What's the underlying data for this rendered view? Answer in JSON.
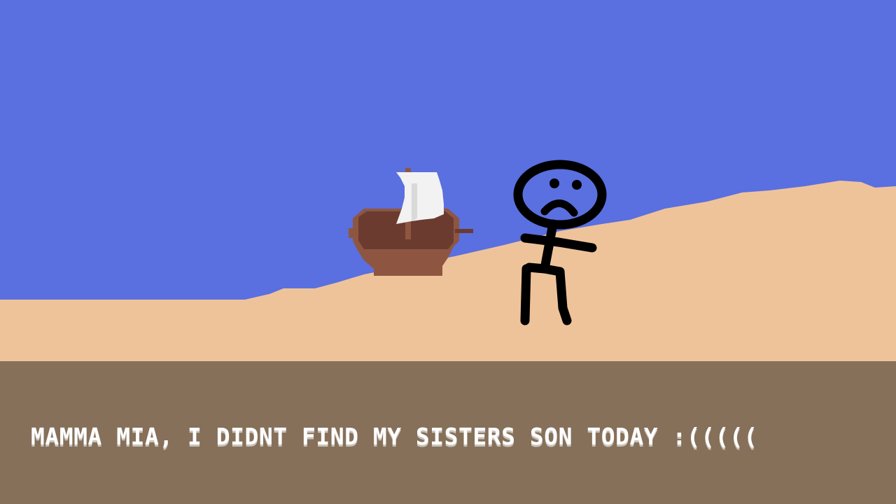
{
  "scene": {
    "colors": {
      "sky": "#5a6fe0",
      "sand": "#efc39a",
      "ground": "#86705a",
      "boat_hull_dark": "#6b3b30",
      "boat_hull_light": "#8e5640",
      "sail": "#f2f2f2",
      "character": "#000000"
    },
    "objects": [
      "sailboat",
      "stick-figure-sad"
    ]
  },
  "dialog": {
    "text": "MAMMA MIA, I DIDNT FIND MY SISTERS SON TODAY :((((("
  }
}
